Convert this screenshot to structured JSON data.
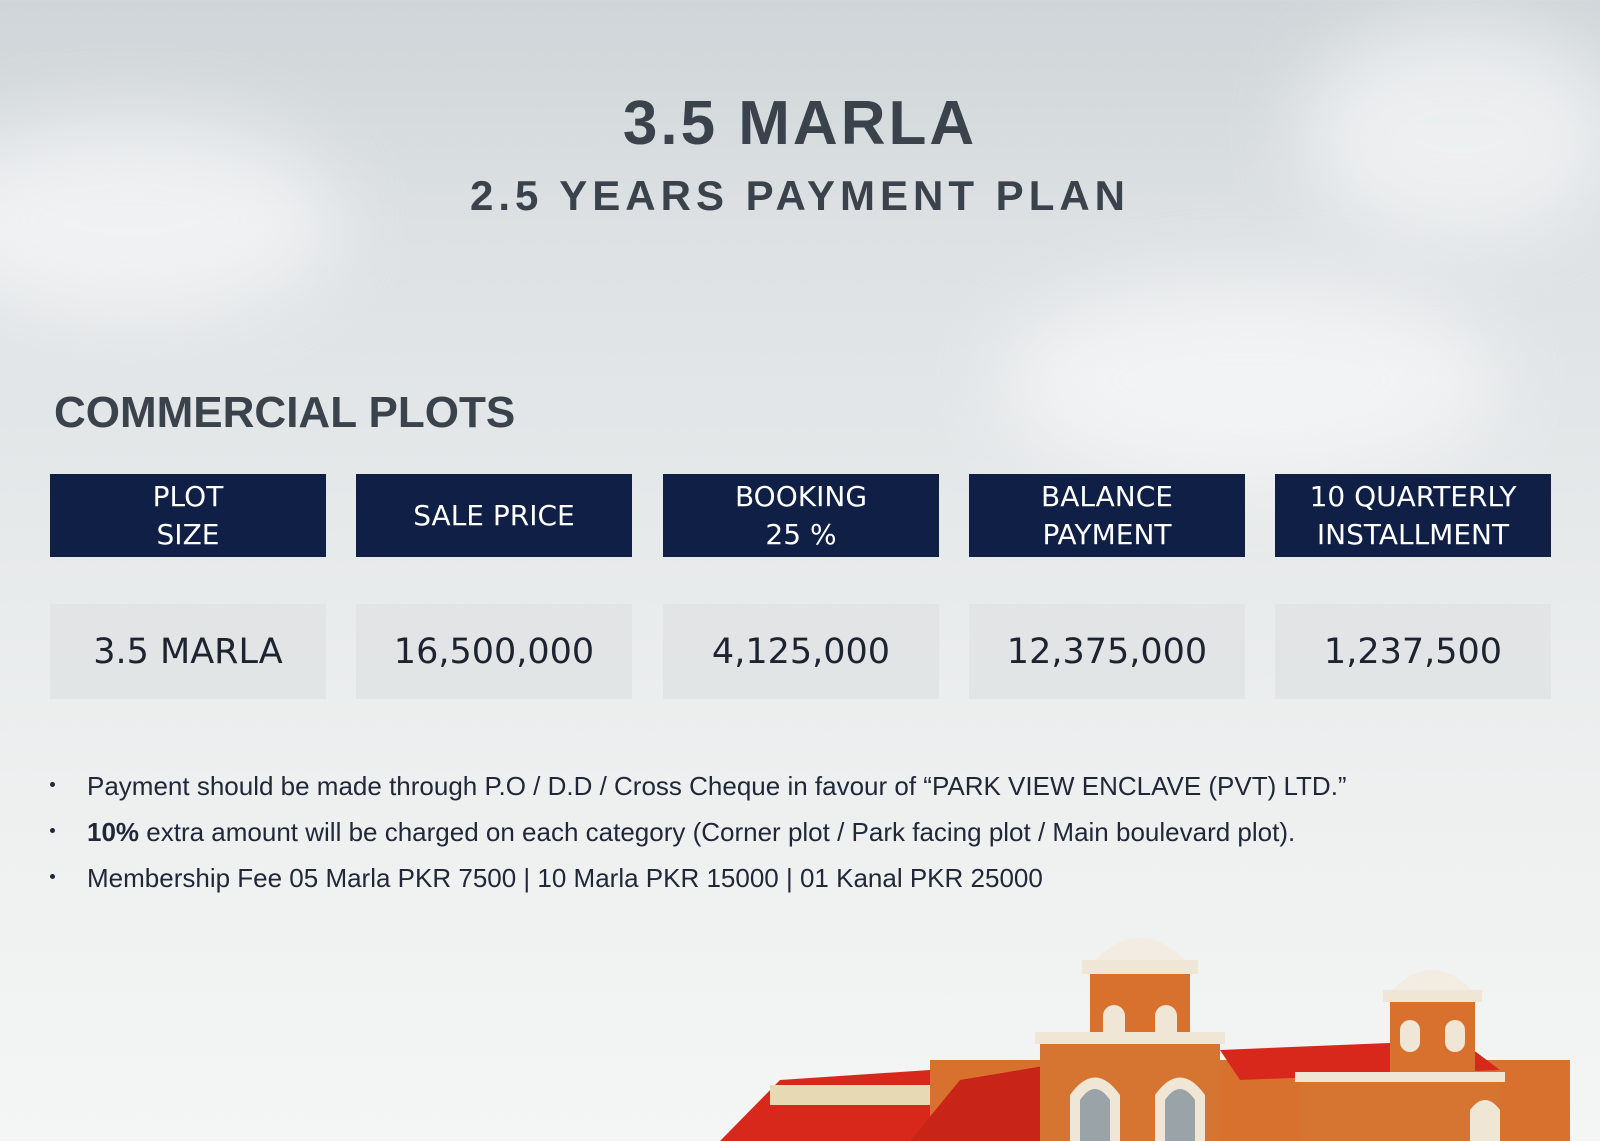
{
  "header": {
    "title": "3.5 MARLA",
    "subtitle": "2.5 YEARS PAYMENT PLAN"
  },
  "section": {
    "heading": "COMMERCIAL PLOTS"
  },
  "table": {
    "columns": [
      "PLOT\nSIZE",
      "SALE PRICE",
      "BOOKING\n25 %",
      "BALANCE\nPAYMENT",
      "10 QUARTERLY\nINSTALLMENT"
    ],
    "row": [
      "3.5 MARLA",
      "16,500,000",
      "4,125,000",
      "12,375,000",
      "1,237,500"
    ]
  },
  "notes": {
    "note1": "Payment should be made through P.O / D.D / Cross Cheque in favour of “PARK VIEW ENCLAVE (PVT) LTD.”",
    "note2_bold": "10%",
    "note2_rest": " extra amount will be charged on each category (Corner plot / Park facing plot / Main boulevard plot).",
    "note3": "Membership Fee 05 Marla PKR 7500 | 10 Marla PKR 15000 | 01 Kanal PKR 25000"
  },
  "colors": {
    "header_bg": "#0f1f45",
    "cell_bg": "#e1e3e4",
    "title_text": "#3a424c",
    "building_brick": "#d9712e",
    "roof_red": "#d8281c"
  }
}
